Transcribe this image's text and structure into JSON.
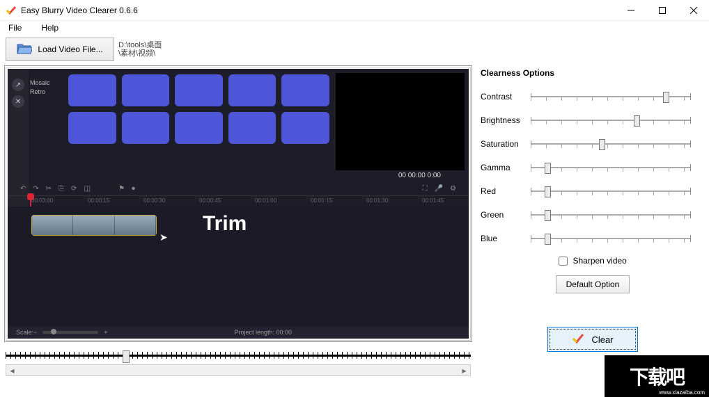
{
  "window": {
    "title": "Easy Blurry Video Clearer 0.6.6"
  },
  "menu": {
    "file": "File",
    "help": "Help"
  },
  "toolbar": {
    "load_label": "Load Video File...",
    "file_path": "D:\\tools\\桌面\\素材\\视频\\"
  },
  "preview": {
    "side_labels": [
      "Mosaic",
      "Retro"
    ],
    "timecode": "00 00:00 0:00",
    "trim_label": "Trim",
    "footer_scale": "Scale:",
    "footer_length": "Project length:  00:00",
    "ruler_labels": [
      "00:03:00",
      "00:00:15",
      "00:00:30",
      "00:00:45",
      "00:01:00",
      "00:01:15",
      "00:01:30",
      "00:01:45"
    ]
  },
  "options": {
    "title": "Clearness Options",
    "rows": [
      {
        "label": "Contrast",
        "pos": 0.78
      },
      {
        "label": "Brightness",
        "pos": 0.61
      },
      {
        "label": "Saturation",
        "pos": 0.41
      },
      {
        "label": "Gamma",
        "pos": 0.1
      },
      {
        "label": "Red",
        "pos": 0.1
      },
      {
        "label": "Green",
        "pos": 0.1
      },
      {
        "label": "Blue",
        "pos": 0.1
      }
    ],
    "sharpen_label": "Sharpen video",
    "sharpen_checked": false,
    "default_label": "Default Option",
    "clear_label": "Clear"
  },
  "watermark": {
    "big": "下载吧",
    "url": "www.xiazaiba.com"
  }
}
